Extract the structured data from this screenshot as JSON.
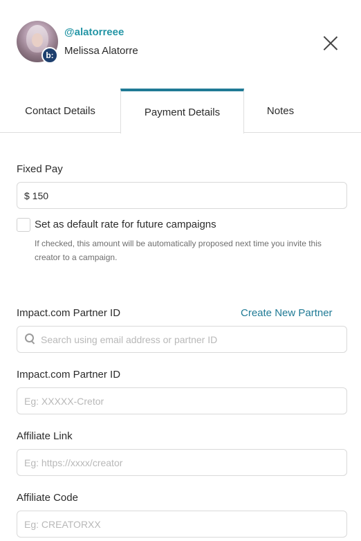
{
  "creator": {
    "handle": "@alatorreee",
    "name": "Melissa Alatorre",
    "platform_badge": "b:"
  },
  "tabs": [
    {
      "label": "Contact Details",
      "active": false
    },
    {
      "label": "Payment Details",
      "active": true
    },
    {
      "label": "Notes",
      "active": false
    }
  ],
  "fixed_pay": {
    "label": "Fixed Pay",
    "value": "$ 150"
  },
  "default_rate": {
    "checked": false,
    "label": "Set as default rate for future campaigns",
    "help": "If checked, this amount will be automatically proposed next time you invite this creator to a campaign."
  },
  "partner_search": {
    "label": "Impact.com Partner ID",
    "create_link": "Create New Partner",
    "placeholder": "Search using email address or partner ID"
  },
  "partner_id": {
    "label": "Impact.com Partner ID",
    "placeholder": "Eg: XXXXX-Cretor"
  },
  "affiliate_link": {
    "label": "Affiliate Link",
    "placeholder": "Eg: https://xxxx/creator"
  },
  "affiliate_code": {
    "label": "Affiliate Code",
    "placeholder": "Eg: CREATORXX"
  },
  "colors": {
    "accent": "#1f7a95",
    "handle": "#2596a6",
    "badge": "#1d3f6e"
  }
}
